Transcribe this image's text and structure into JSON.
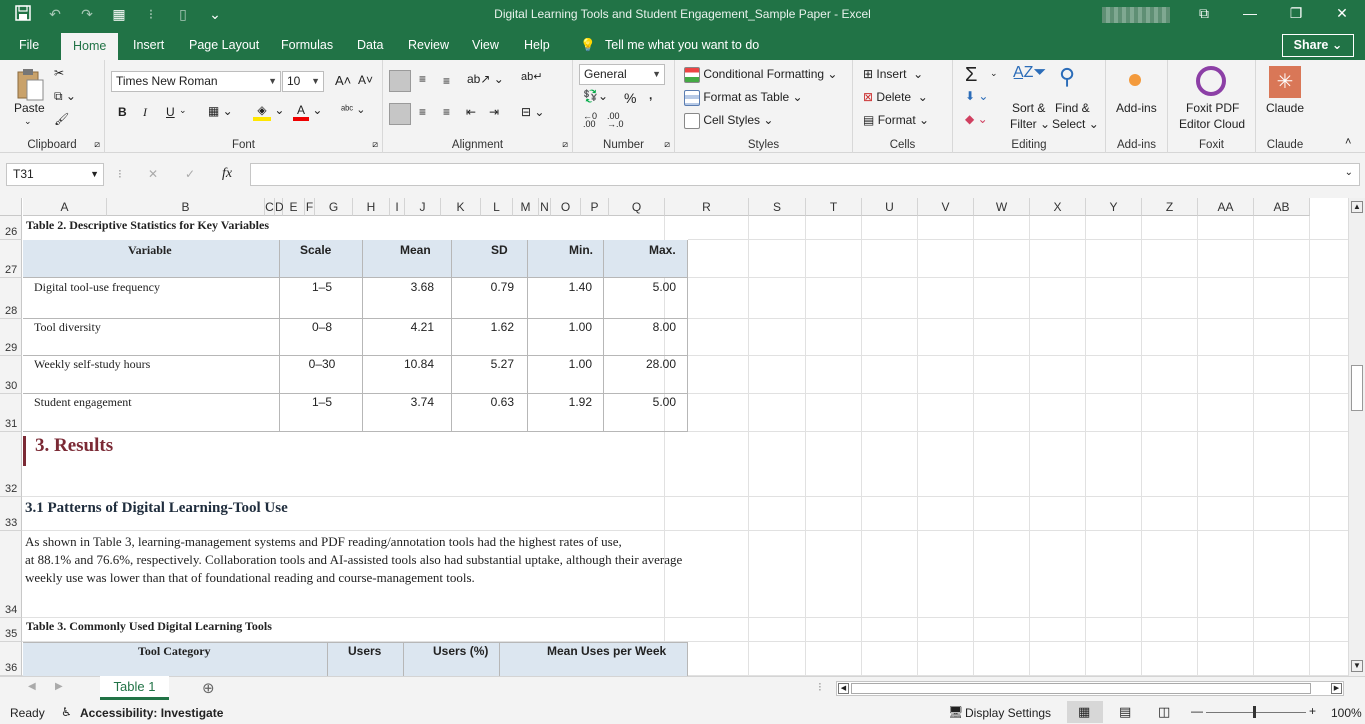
{
  "window": {
    "title": "Digital Learning Tools and Student Engagement_Sample Paper  -  Excel",
    "minimize": "—",
    "restore": "❐",
    "close": "✕",
    "ribbon_display": "⧉"
  },
  "tabs": [
    "File",
    "Home",
    "Insert",
    "Page Layout",
    "Formulas",
    "Data",
    "Review",
    "View",
    "Help"
  ],
  "active_tab": "Home",
  "tell_me": "Tell me what you want to do",
  "share_label": "Share",
  "ribbon": {
    "clipboard": {
      "paste": "Paste",
      "label": "Clipboard"
    },
    "font": {
      "name": "Times New Roman",
      "size": "10",
      "bold": "B",
      "italic": "I",
      "underline": "U",
      "label": "Font"
    },
    "alignment": {
      "label": "Alignment"
    },
    "number": {
      "format": "General",
      "percent": "%",
      "comma": ",",
      "label": "Number"
    },
    "styles": {
      "conditional": "Conditional Formatting",
      "format_table": "Format as Table",
      "cell_styles": "Cell Styles",
      "label": "Styles"
    },
    "cells": {
      "insert": "Insert",
      "delete": "Delete",
      "format": "Format",
      "label": "Cells"
    },
    "editing": {
      "sum": "Σ",
      "sort": "Sort &",
      "filter": "Filter",
      "find": "Find &",
      "select": "Select",
      "label": "Editing"
    },
    "addins": {
      "btn": "Add-ins",
      "label": "Add-ins"
    },
    "foxit": {
      "btn1": "Foxit PDF",
      "btn2": "Editor Cloud",
      "label": "Foxit"
    },
    "claude": {
      "btn": "Claude",
      "label": "Claude"
    }
  },
  "formula_bar": {
    "name_box": "T31",
    "fx": "fx",
    "cancel": "✕",
    "enter": "✓",
    "value": ""
  },
  "columns": [
    "A",
    "B",
    "C",
    "D",
    "E",
    "F",
    "G",
    "H",
    "I",
    "J",
    "K",
    "L",
    "M",
    "N",
    "O",
    "P",
    "Q",
    "R",
    "S",
    "T",
    "U",
    "V",
    "W",
    "X",
    "Y",
    "Z",
    "AA",
    "AB"
  ],
  "rows": [
    "26",
    "27",
    "28",
    "29",
    "30",
    "31",
    "32",
    "33",
    "34",
    "35",
    "36"
  ],
  "content": {
    "table2_title": "Table 2. Descriptive Statistics for Key Variables",
    "table2_headers": [
      "Variable",
      "Scale",
      "Mean",
      "SD",
      "Min.",
      "Max."
    ],
    "table2_rows": [
      [
        "Digital tool-use frequency",
        "1–5",
        "3.68",
        "0.79",
        "1.40",
        "5.00"
      ],
      [
        "Tool diversity",
        "0–8",
        "4.21",
        "1.62",
        "1.00",
        "8.00"
      ],
      [
        "Weekly self-study hours",
        "0–30",
        "10.84",
        "5.27",
        "1.00",
        "28.00"
      ],
      [
        "Student engagement",
        "1–5",
        "3.74",
        "0.63",
        "1.92",
        "5.00"
      ]
    ],
    "section3": "3. Results",
    "section31": "3.1 Patterns of Digital Learning-Tool Use",
    "paragraph": [
      "As shown in Table 3, learning-management systems and PDF reading/annotation tools had the highest rates of use,",
      "at 88.1% and 76.6%, respectively. Collaboration tools and AI-assisted tools also had substantial uptake, although their average",
      "weekly use was lower than that of foundational reading and course-management tools."
    ],
    "table3_title": "Table 3. Commonly Used Digital Learning Tools",
    "table3_headers": [
      "Tool Category",
      "Users",
      "Users (%)",
      "Mean Uses per Week"
    ]
  },
  "sheet_tabs": [
    "Table 1"
  ],
  "status": {
    "ready": "Ready",
    "accessibility": "Accessibility: Investigate",
    "display": "Display Settings",
    "zoom": "100%"
  },
  "colors": {
    "excel_green": "#217346",
    "header_fill": "#dce6f0",
    "heading_red": "#7b2a35"
  }
}
